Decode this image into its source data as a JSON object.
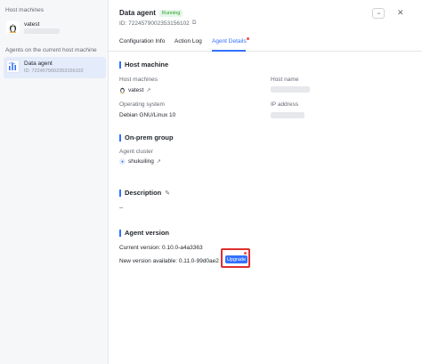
{
  "sidebar": {
    "host_section_title": "Host machines",
    "host_item": {
      "name": "vatest"
    },
    "agents_section_title": "Agents on the current host machine",
    "agent_item": {
      "name": "Data agent",
      "id": "ID: 7224579002353156102"
    }
  },
  "header": {
    "title": "Data agent",
    "status": "Running",
    "id": "ID: 7224579002353156102",
    "more_label": "···",
    "close_label": "✕"
  },
  "tabs": [
    {
      "label": "Configuration Info"
    },
    {
      "label": "Action Log"
    },
    {
      "label": "Agent Details"
    }
  ],
  "host_machine": {
    "title": "Host machine",
    "host_machines_label": "Host machines",
    "host_machines_value": "vatest",
    "host_name_label": "Host name",
    "os_label": "Operating system",
    "os_value": "Debian GNU/Linux 10",
    "ip_label": "IP address"
  },
  "onprem": {
    "title": "On-prem group",
    "cluster_label": "Agent cluster",
    "cluster_value": "shukuiling"
  },
  "description": {
    "title": "Description",
    "value": "--"
  },
  "agent_version": {
    "title": "Agent version",
    "current": "Current version: 0.10.0-a4a3363",
    "new": "New version available: 0.11.0-99d0ae2",
    "upgrade_label": "Upgrade"
  },
  "colors": {
    "accent": "#3370ff",
    "running_bg": "#e4f6ea",
    "running_text": "#2ea121",
    "highlight": "#e02e2e"
  }
}
